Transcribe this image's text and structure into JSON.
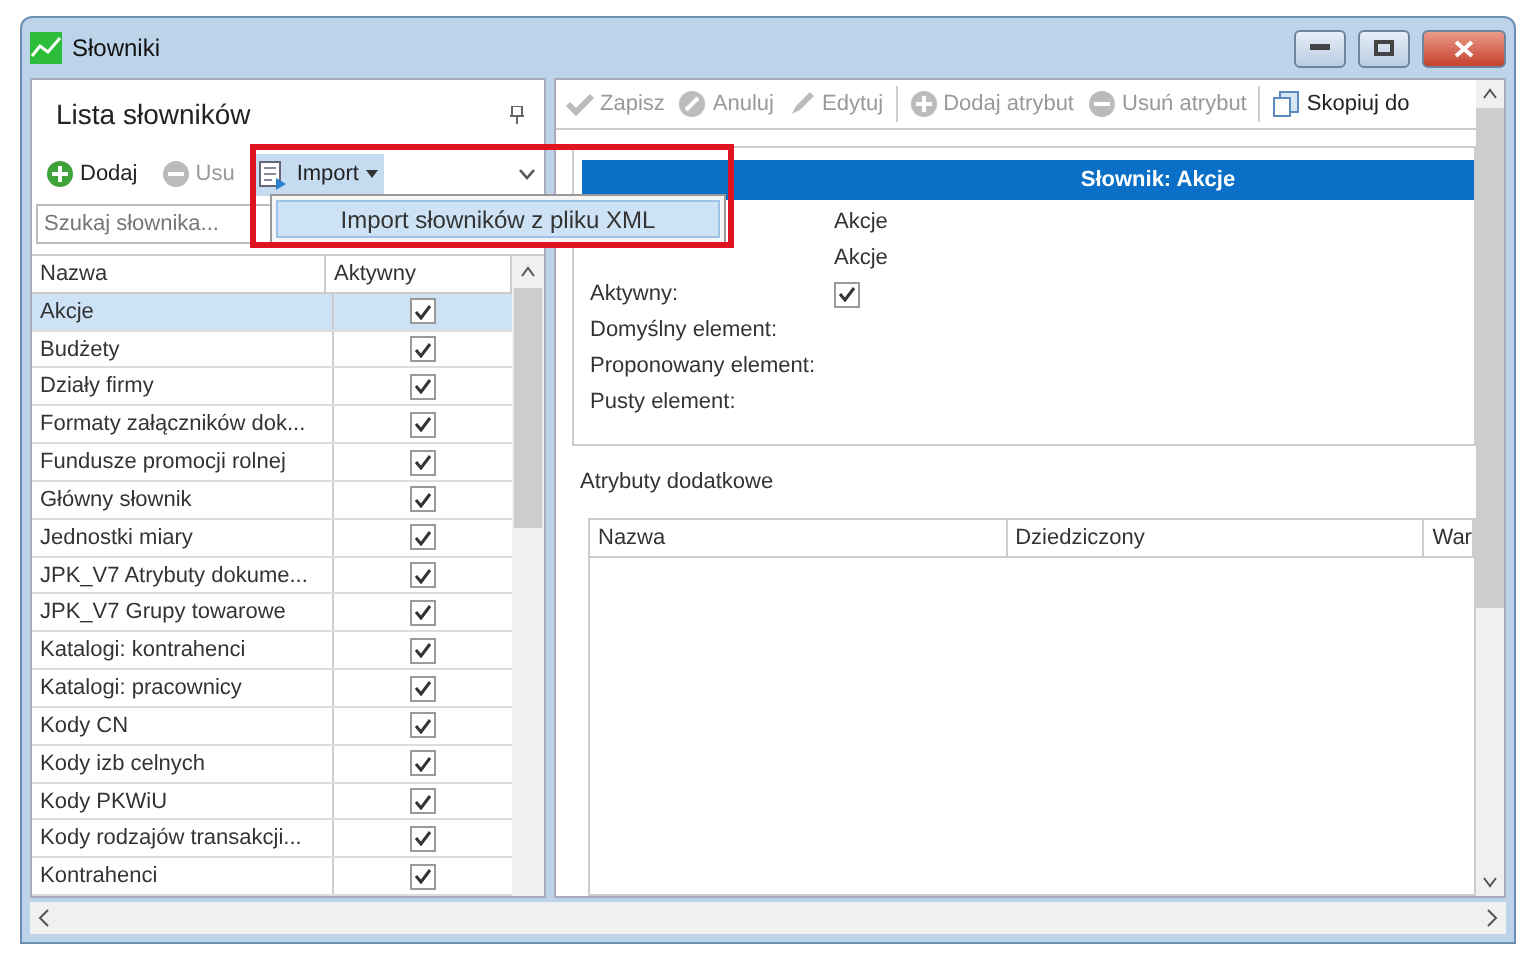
{
  "window": {
    "title": "Słowniki"
  },
  "left_panel": {
    "title": "Lista słowników",
    "toolbar": [
      {
        "kind": "add",
        "label": "Dodaj",
        "disabled": false
      },
      {
        "kind": "remove",
        "label": "Usu",
        "disabled": true
      },
      {
        "kind": "import",
        "label": "Import",
        "disabled": false
      }
    ],
    "import_menu": {
      "items": [
        "Import słowników z pliku XML"
      ]
    },
    "search": {
      "placeholder": "Szukaj słownika..."
    },
    "columns": [
      "Nazwa",
      "Aktywny"
    ],
    "rows": [
      {
        "name": "Akcje",
        "active": true,
        "selected": true
      },
      {
        "name": "Budżety",
        "active": true,
        "selected": false
      },
      {
        "name": "Działy firmy",
        "active": true,
        "selected": false
      },
      {
        "name": "Formaty załączników dok...",
        "active": true,
        "selected": false
      },
      {
        "name": "Fundusze promocji rolnej",
        "active": true,
        "selected": false
      },
      {
        "name": "Główny słownik",
        "active": true,
        "selected": false
      },
      {
        "name": "Jednostki miary",
        "active": true,
        "selected": false
      },
      {
        "name": "JPK_V7 Atrybuty dokume...",
        "active": true,
        "selected": false
      },
      {
        "name": "JPK_V7 Grupy towarowe",
        "active": true,
        "selected": false
      },
      {
        "name": "Katalogi: kontrahenci",
        "active": true,
        "selected": false
      },
      {
        "name": "Katalogi: pracownicy",
        "active": true,
        "selected": false
      },
      {
        "name": "Kody CN",
        "active": true,
        "selected": false
      },
      {
        "name": "Kody izb celnych",
        "active": true,
        "selected": false
      },
      {
        "name": "Kody PKWiU",
        "active": true,
        "selected": false
      },
      {
        "name": "Kody rodzajów transakcji...",
        "active": true,
        "selected": false
      },
      {
        "name": "Kontrahenci",
        "active": true,
        "selected": false
      }
    ]
  },
  "right_panel": {
    "toolbar": [
      {
        "kind": "save",
        "label": "Zapisz",
        "disabled": true
      },
      {
        "kind": "cancel",
        "label": "Anuluj",
        "disabled": true
      },
      {
        "kind": "edit",
        "label": "Edytuj",
        "disabled": true
      },
      {
        "kind": "separator"
      },
      {
        "kind": "add",
        "label": "Dodaj atrybut",
        "disabled": true
      },
      {
        "kind": "remove",
        "label": "Usuń atrybut",
        "disabled": true
      },
      {
        "kind": "separator"
      },
      {
        "kind": "copy",
        "label": "Skopiuj do",
        "disabled": false
      }
    ],
    "header": "Słownik: Akcje",
    "fields": [
      {
        "kind": "text",
        "value": "Akcje"
      },
      {
        "kind": "text",
        "value": "Akcje"
      },
      {
        "kind": "check",
        "label": "Aktywny:",
        "checked": true
      },
      {
        "kind": "text",
        "label": "Domyślny element:"
      },
      {
        "kind": "text",
        "label": "Proponowany element:"
      },
      {
        "kind": "text",
        "label": "Pusty element:"
      }
    ],
    "attributes": {
      "title": "Atrybuty dodatkowe",
      "columns": [
        "Nazwa",
        "Dziedziczony",
        "War"
      ]
    }
  }
}
